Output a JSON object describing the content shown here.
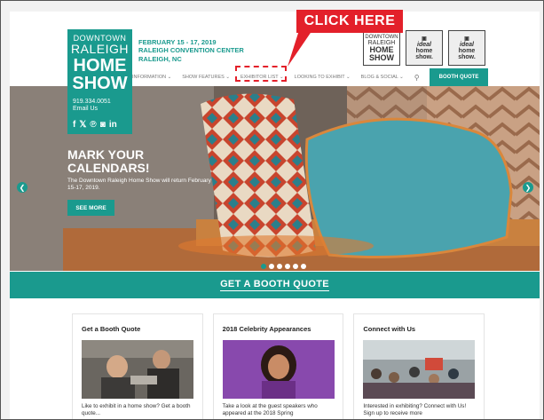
{
  "callout": {
    "label": "CLICK HERE",
    "color": "#e3202a"
  },
  "logo": {
    "line1": "DOWNTOWN",
    "line2": "RALEIGH",
    "line3": "HOME",
    "line4": "SHOW",
    "phone": "919.334.0051",
    "email": "Email Us",
    "social": [
      "f",
      "𝕏",
      "℗",
      "◙",
      "in"
    ]
  },
  "event": {
    "dates": "FEBRUARY 15 - 17, 2019",
    "venue": "RALEIGH CONVENTION CENTER",
    "city": "RALEIGH, NC"
  },
  "partners": [
    {
      "name": "DOWNTOWN RALEIGH HOME SHOW"
    },
    {
      "name": "ideal home show"
    },
    {
      "name": "ideal home show"
    }
  ],
  "nav": {
    "items": [
      "INFORMATION ⌄",
      "SHOW FEATURES ⌄",
      "EXHIBITOR LIST ⌄",
      "LOOKING TO EXHIBIT ⌄",
      "BLOG & SOCIAL ⌄"
    ],
    "search_icon": "search-icon",
    "booth_button": "BOOTH QUOTE"
  },
  "hero": {
    "title_line1": "MARK YOUR",
    "title_line2": "CALENDARS!",
    "subtitle": "The Downtown Raleigh Home Show will return February 15-17, 2019.",
    "button": "SEE MORE",
    "slide_count": 6,
    "active_slide": 0
  },
  "quote_bar": {
    "label": "GET A BOOTH QUOTE"
  },
  "cards": [
    {
      "title": "Get a Booth Quote",
      "text": "Like to exhibit in a home show? Get a booth quote..."
    },
    {
      "title": "2018 Celebrity Appearances",
      "text": "Take a look at the guest speakers who appeared at the 2018 Spring"
    },
    {
      "title": "Connect with Us",
      "text": "Interested in exhibiting? Connect with Us! Sign up to receive more"
    }
  ],
  "colors": {
    "brand": "#1a9a8e",
    "accent": "#e3202a"
  }
}
